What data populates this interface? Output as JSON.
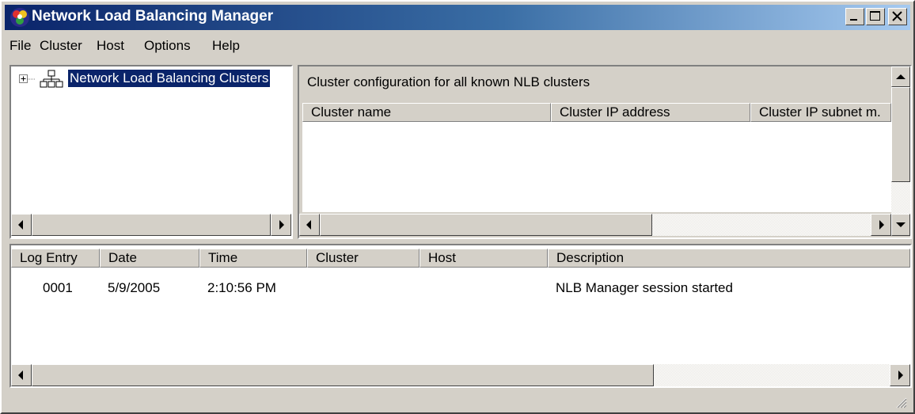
{
  "window": {
    "title": "Network Load Balancing Manager"
  },
  "menu": {
    "items": [
      {
        "label": "File"
      },
      {
        "label": "Cluster"
      },
      {
        "label": "Host"
      },
      {
        "label": "Options"
      },
      {
        "label": "Help"
      }
    ]
  },
  "tree": {
    "root_label": "Network Load Balancing Clusters",
    "expand_glyph": "+"
  },
  "cluster_pane": {
    "caption": "Cluster configuration for all known NLB clusters",
    "columns": [
      "Cluster name",
      "Cluster IP address",
      "Cluster IP subnet m."
    ]
  },
  "log": {
    "columns": [
      "Log Entry",
      "Date",
      "Time",
      "Cluster",
      "Host",
      "Description"
    ],
    "rows": [
      {
        "entry": "0001",
        "date": "5/9/2005",
        "time": "2:10:56 PM",
        "cluster": "",
        "host": "",
        "description": "NLB Manager session started"
      }
    ]
  },
  "colors": {
    "title_start": "#0a246a",
    "title_end": "#a6caf0",
    "selection": "#0a246a",
    "face": "#d4d0c8"
  },
  "icons": [
    "app-icon",
    "minimize-icon",
    "maximize-icon",
    "close-icon",
    "tree-expand-icon",
    "cluster-network-icon",
    "scroll-left-icon",
    "scroll-right-icon",
    "scroll-up-icon",
    "scroll-down-icon",
    "resize-grip-icon"
  ]
}
